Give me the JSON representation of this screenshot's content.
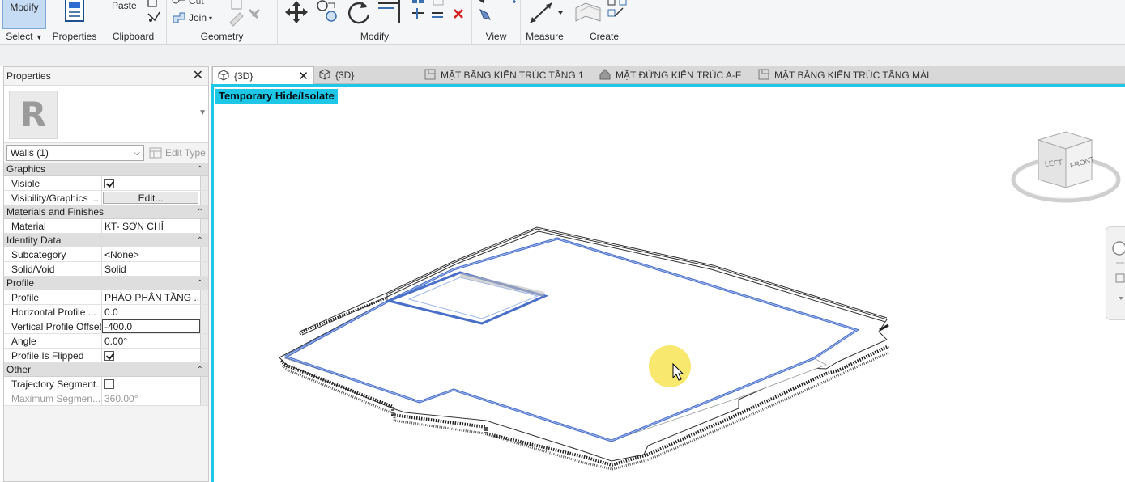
{
  "ribbon": {
    "modify_label": "Modify",
    "select_label": "Select",
    "properties_label": "Properties",
    "clipboard": {
      "label": "Clipboard",
      "paste": "Paste"
    },
    "geometry": {
      "label": "Geometry",
      "cut": "Cut",
      "join": "Join"
    },
    "modify": {
      "label": "Modify"
    },
    "view": {
      "label": "View"
    },
    "measure": {
      "label": "Measure"
    },
    "create": {
      "label": "Create"
    }
  },
  "properties": {
    "title": "Properties",
    "close": "✕",
    "logo_letter": "R",
    "type_selector": "Walls (1)",
    "edit_type": "Edit Type",
    "categories": [
      {
        "name": "Graphics",
        "rows": [
          {
            "key": "Visible",
            "value": "",
            "checkbox": true,
            "checked": true
          },
          {
            "key": "Visibility/Graphics ...",
            "value": "Edit...",
            "button": true
          }
        ]
      },
      {
        "name": "Materials and Finishes",
        "rows": [
          {
            "key": "Material",
            "value": "KT- SƠN CHỈ"
          }
        ]
      },
      {
        "name": "Identity Data",
        "rows": [
          {
            "key": "Subcategory",
            "value": "<None>"
          },
          {
            "key": "Solid/Void",
            "value": "Solid"
          }
        ]
      },
      {
        "name": "Profile",
        "rows": [
          {
            "key": "Profile",
            "value": "PHÀO PHÂN TẦNG ..."
          },
          {
            "key": "Horizontal Profile ...",
            "value": "0.0"
          },
          {
            "key": "Vertical Profile Offset",
            "value": "-400.0",
            "active": true
          },
          {
            "key": "Angle",
            "value": "0.00°"
          },
          {
            "key": "Profile Is Flipped",
            "value": "",
            "checkbox": true,
            "checked": true
          }
        ]
      },
      {
        "name": "Other",
        "rows": [
          {
            "key": "Trajectory Segment...",
            "value": "",
            "checkbox": true,
            "checked": false
          },
          {
            "key": "Maximum Segmen...",
            "value": "360.00°",
            "dim": true
          }
        ]
      }
    ]
  },
  "tabs": [
    {
      "label": "{3D}",
      "active": true,
      "icon": "3d-view-icon"
    },
    {
      "label": "{3D}",
      "active": false,
      "icon": "3d-view-icon"
    },
    {
      "label": "MẶT BẰNG KIẾN TRÚC TẦNG 1",
      "active": false,
      "icon": "floor-plan-icon"
    },
    {
      "label": "MẶT ĐỨNG KIẾN TRÚC A-F",
      "active": false,
      "icon": "elevation-icon"
    },
    {
      "label": "MẶT BẰNG KIẾN TRÚC TẦNG MÁI",
      "active": false,
      "icon": "floor-plan-icon"
    }
  ],
  "viewport": {
    "banner": "Temporary Hide/Isolate",
    "viewcube": {
      "left": "LEFT",
      "front": "FRONT"
    },
    "colors": {
      "accent": "#1ec7e6",
      "selection": "#4a6fc9",
      "highlight": "#f6e24a"
    }
  }
}
